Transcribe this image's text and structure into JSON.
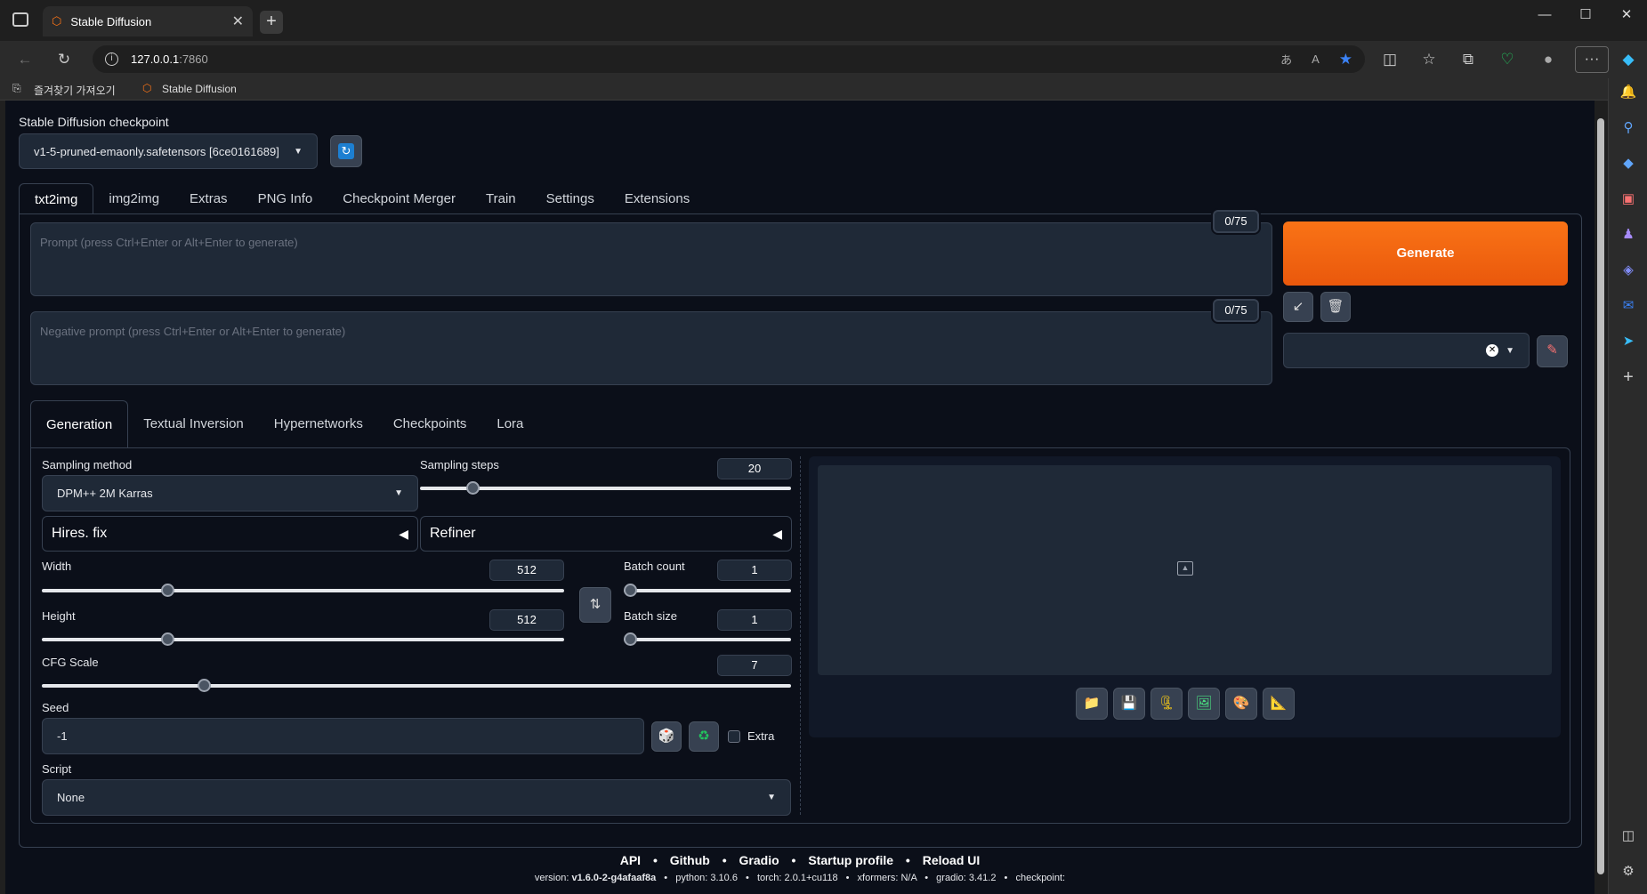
{
  "browser": {
    "tab_title": "Stable Diffusion",
    "url_host": "127.0.0.1",
    "url_port": ":7860",
    "bookmarks": [
      {
        "label": "즐겨찾기 가져오기"
      },
      {
        "label": "Stable Diffusion"
      }
    ]
  },
  "checkpoint": {
    "label": "Stable Diffusion checkpoint",
    "value": "v1-5-pruned-emaonly.safetensors [6ce0161689]"
  },
  "main_tabs": [
    "txt2img",
    "img2img",
    "Extras",
    "PNG Info",
    "Checkpoint Merger",
    "Train",
    "Settings",
    "Extensions"
  ],
  "prompt": {
    "placeholder": "Prompt (press Ctrl+Enter or Alt+Enter to generate)",
    "token_count": "0/75"
  },
  "negative_prompt": {
    "placeholder": "Negative prompt (press Ctrl+Enter or Alt+Enter to generate)",
    "token_count": "0/75"
  },
  "generate_label": "Generate",
  "sub_tabs": [
    "Generation",
    "Textual Inversion",
    "Hypernetworks",
    "Checkpoints",
    "Lora"
  ],
  "sampling": {
    "method_label": "Sampling method",
    "method_value": "DPM++ 2M Karras",
    "steps_label": "Sampling steps",
    "steps_value": "20",
    "steps_fraction": 0.13
  },
  "hires_label": "Hires. fix",
  "refiner_label": "Refiner",
  "width": {
    "label": "Width",
    "value": "512",
    "fraction": 0.235
  },
  "height": {
    "label": "Height",
    "value": "512",
    "fraction": 0.235
  },
  "batch_count": {
    "label": "Batch count",
    "value": "1",
    "fraction": 0.0
  },
  "batch_size": {
    "label": "Batch size",
    "value": "1",
    "fraction": 0.0
  },
  "cfg": {
    "label": "CFG Scale",
    "value": "7",
    "fraction": 0.2115
  },
  "seed": {
    "label": "Seed",
    "value": "-1",
    "extra_label": "Extra"
  },
  "script": {
    "label": "Script",
    "value": "None"
  },
  "footer": {
    "links": [
      "API",
      "Github",
      "Gradio",
      "Startup profile",
      "Reload UI"
    ],
    "version_line": [
      {
        "k": "version: ",
        "v": "v1.6.0-2-g4afaaf8a"
      },
      {
        "k": "python: ",
        "v": "3.10.6"
      },
      {
        "k": "torch: ",
        "v": "2.0.1+cu118"
      },
      {
        "k": "xformers: ",
        "v": "N/A"
      },
      {
        "k": "gradio: ",
        "v": "3.41.2"
      },
      {
        "k": "checkpoint: ",
        "v": ""
      }
    ]
  },
  "colors": {
    "accent": "#f97316",
    "background": "#0b0f19",
    "panel": "#1f2937"
  },
  "icons": [
    "sidebar-toggle-icon",
    "refresh-icon",
    "image-placeholder-icon",
    "folder-icon",
    "save-icon",
    "zip-icon",
    "image-icon",
    "palette-icon",
    "ruler-icon",
    "dice-icon",
    "recycle-icon",
    "swap-icon",
    "pencil-icon",
    "trash-icon",
    "arrow-icon",
    "brush-icon"
  ]
}
